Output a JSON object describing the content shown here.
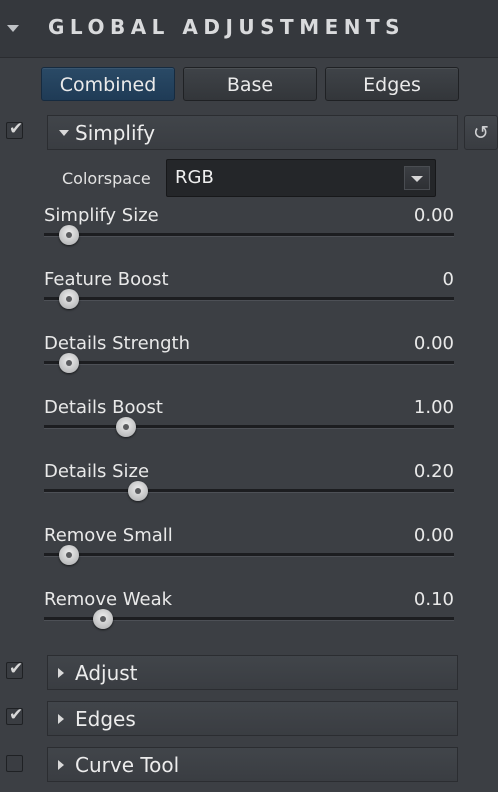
{
  "panel": {
    "title": "GLOBAL ADJUSTMENTS"
  },
  "tabs": [
    {
      "label": "Combined",
      "active": true
    },
    {
      "label": "Base",
      "active": false
    },
    {
      "label": "Edges",
      "active": false
    }
  ],
  "simplify": {
    "label": "Simplify",
    "enabled": true,
    "expanded": true,
    "reset_icon": "reset-icon",
    "colorspace": {
      "label": "Colorspace",
      "value": "RGB"
    },
    "sliders": [
      {
        "name": "Simplify Size",
        "value": "0.00",
        "position": 0.06
      },
      {
        "name": "Feature Boost",
        "value": "0",
        "position": 0.06
      },
      {
        "name": "Details Strength",
        "value": "0.00",
        "position": 0.06
      },
      {
        "name": "Details Boost",
        "value": "1.00",
        "position": 0.2
      },
      {
        "name": "Details Size",
        "value": "0.20",
        "position": 0.23
      },
      {
        "name": "Remove Small",
        "value": "0.00",
        "position": 0.06
      },
      {
        "name": "Remove Weak",
        "value": "0.10",
        "position": 0.145
      }
    ]
  },
  "sections": [
    {
      "label": "Adjust",
      "enabled": true
    },
    {
      "label": "Edges",
      "enabled": true
    },
    {
      "label": "Curve Tool",
      "enabled": false
    }
  ],
  "icons": {
    "check": "✔",
    "reset": "↺"
  }
}
